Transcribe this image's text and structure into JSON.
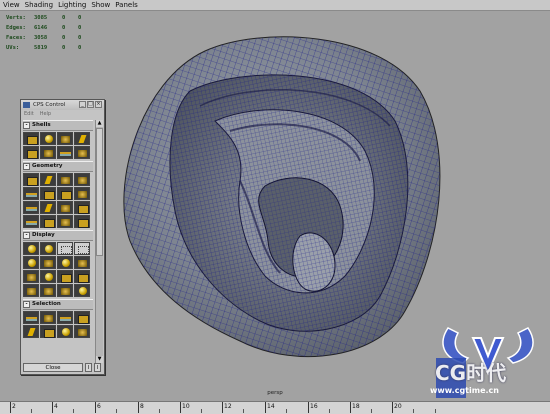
{
  "menubar": {
    "items": [
      "View",
      "Shading",
      "Lighting",
      "Show",
      "Panels"
    ]
  },
  "hud": {
    "rows": [
      {
        "label": "Verts:",
        "value": "3085",
        "a": "0",
        "b": "0"
      },
      {
        "label": "Edges:",
        "value": "6146",
        "a": "0",
        "b": "0"
      },
      {
        "label": "Faces:",
        "value": "3058",
        "a": "0",
        "b": "0"
      },
      {
        "label": "UVs:",
        "value": "5819",
        "a": "0",
        "b": "0"
      }
    ]
  },
  "camera_label": "persp",
  "timeline": {
    "ticks": [
      "2",
      "4",
      "6",
      "8",
      "10",
      "12",
      "14",
      "16",
      "18",
      "20"
    ]
  },
  "cps": {
    "title": "CPS Control",
    "menu": [
      "Edit",
      "Help"
    ],
    "sections": [
      "Shells",
      "Geometry",
      "Display",
      "Selection"
    ],
    "close_label": "Close",
    "small_btn": "I"
  },
  "watermark": {
    "text": "CG时代",
    "url": "www.cgtime.cn"
  },
  "colors": {
    "mesh_wire": "#1a1a8a",
    "surface": "#808896",
    "hud_text": "#1d4a1d"
  }
}
